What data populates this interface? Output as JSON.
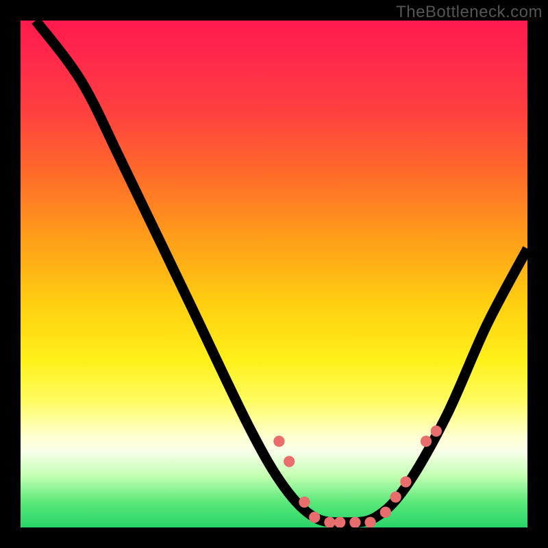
{
  "watermark": "TheBottleneck.com",
  "chart_data": {
    "type": "line",
    "title": "",
    "xlabel": "",
    "ylabel": "",
    "xlim": [
      0,
      100
    ],
    "ylim": [
      0,
      100
    ],
    "series": [
      {
        "name": "curve",
        "points": [
          {
            "x": 3,
            "y": 100
          },
          {
            "x": 12,
            "y": 88
          },
          {
            "x": 20,
            "y": 72
          },
          {
            "x": 33,
            "y": 45
          },
          {
            "x": 45,
            "y": 20
          },
          {
            "x": 52,
            "y": 8
          },
          {
            "x": 58,
            "y": 2
          },
          {
            "x": 64,
            "y": 1
          },
          {
            "x": 70,
            "y": 2
          },
          {
            "x": 76,
            "y": 8
          },
          {
            "x": 84,
            "y": 22
          },
          {
            "x": 92,
            "y": 40
          },
          {
            "x": 100,
            "y": 55
          }
        ]
      }
    ],
    "markers": [
      {
        "x": 51,
        "y": 17
      },
      {
        "x": 53,
        "y": 13
      },
      {
        "x": 56,
        "y": 5
      },
      {
        "x": 58,
        "y": 2
      },
      {
        "x": 61,
        "y": 1
      },
      {
        "x": 63,
        "y": 1
      },
      {
        "x": 66,
        "y": 1
      },
      {
        "x": 69,
        "y": 1
      },
      {
        "x": 72,
        "y": 3
      },
      {
        "x": 74,
        "y": 6
      },
      {
        "x": 76,
        "y": 9
      },
      {
        "x": 80,
        "y": 17
      },
      {
        "x": 82,
        "y": 19
      }
    ],
    "colors": {
      "gradient_top": "#ff1a4d",
      "gradient_mid": "#ffd11a",
      "gradient_bottom": "#28d468",
      "marker": "#e86d6d",
      "line": "#000000",
      "frame": "#000000"
    }
  }
}
